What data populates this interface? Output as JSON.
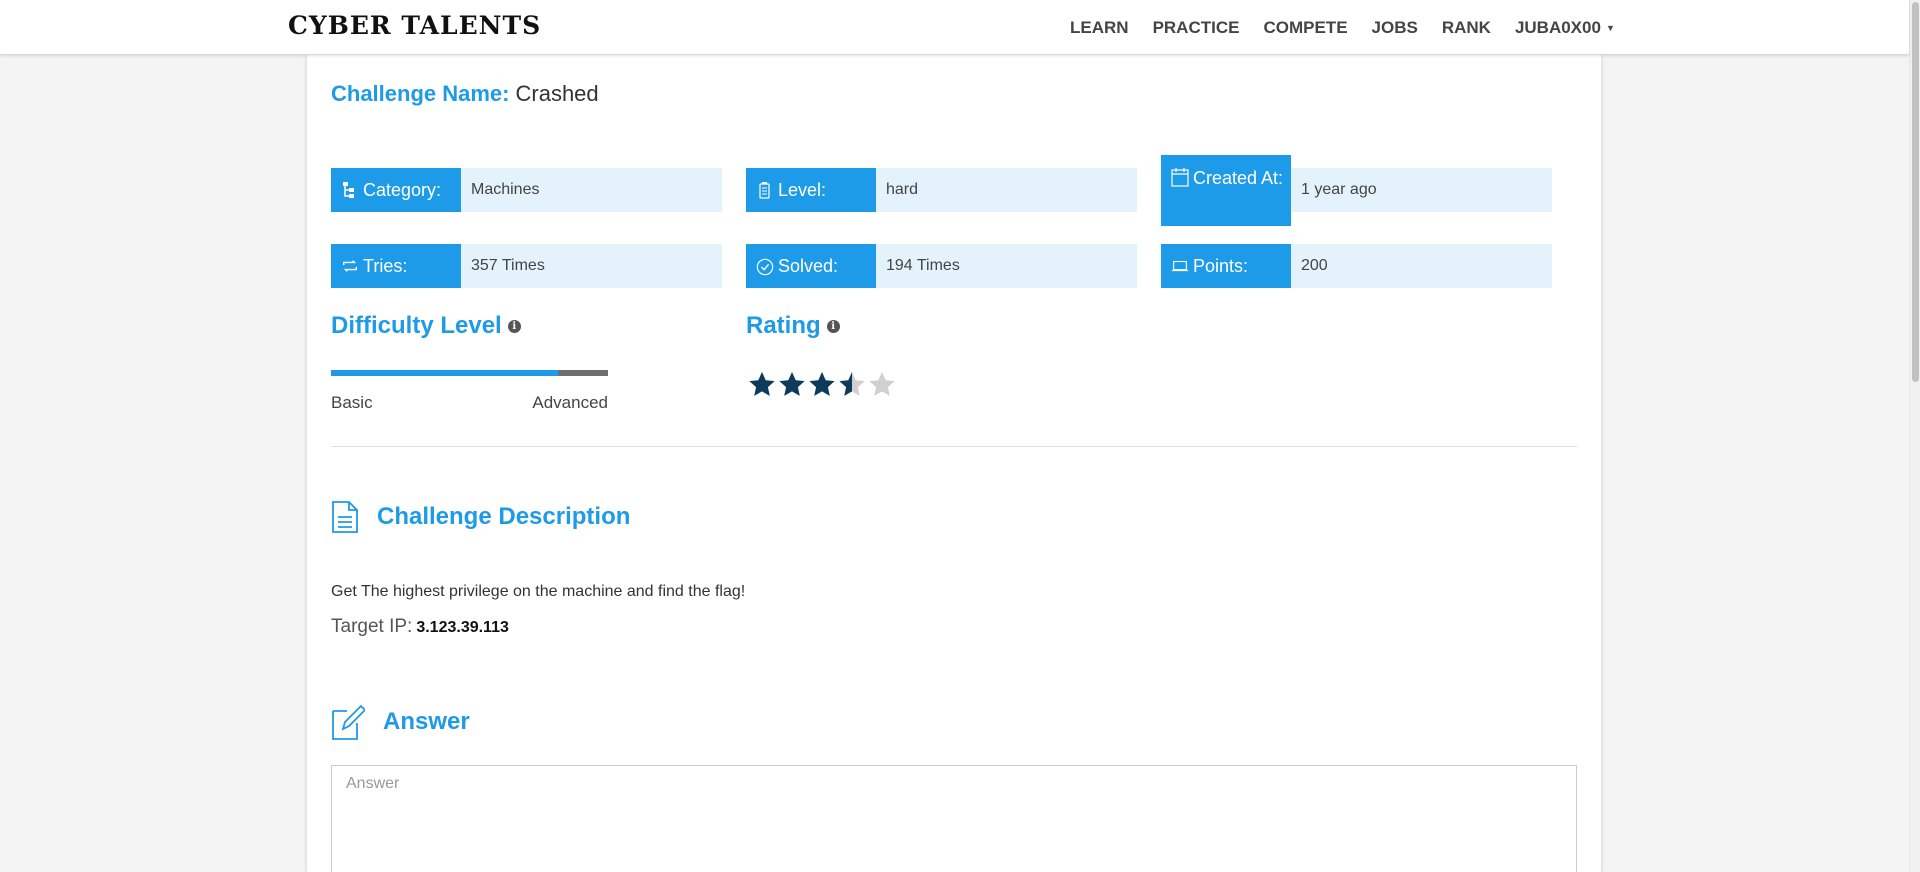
{
  "nav": {
    "brand": "CYBER TALENTS",
    "links": [
      "LEARN",
      "PRACTICE",
      "COMPETE",
      "JOBS",
      "RANK"
    ],
    "user": "JUBA0X00"
  },
  "challenge": {
    "name_label": "Challenge Name:",
    "name_value": "Crashed"
  },
  "info": {
    "category": {
      "label": "Category:",
      "value": "Machines",
      "icon": "sitemap-icon"
    },
    "level": {
      "label": "Level:",
      "value": "hard",
      "icon": "battery-icon"
    },
    "created": {
      "label": "Created At:",
      "value": "1 year ago",
      "icon": "calendar-icon"
    },
    "tries": {
      "label": "Tries:",
      "value": "357 Times",
      "icon": "retweet-icon"
    },
    "solved": {
      "label": "Solved:",
      "value": "194 Times",
      "icon": "check-circle-icon"
    },
    "points": {
      "label": "Points:",
      "value": "200",
      "icon": "laptop-icon"
    }
  },
  "difficulty": {
    "title": "Difficulty Level",
    "level_fraction": 0.82,
    "min_label": "Basic",
    "max_label": "Advanced"
  },
  "rating": {
    "title": "Rating",
    "stars": 3.5,
    "max_stars": 5
  },
  "description": {
    "title": "Challenge Description",
    "text": "Get The highest privilege on the machine and find the flag!",
    "target_label": "Target IP:",
    "target_ip": "3.123.39.113"
  },
  "answer": {
    "title": "Answer",
    "placeholder": "Answer",
    "value": ""
  },
  "colors": {
    "accent": "#1e9be8",
    "info_bg": "#e4f2fc",
    "star_filled": "#0e3a5c",
    "star_empty": "#d0d0d0"
  }
}
